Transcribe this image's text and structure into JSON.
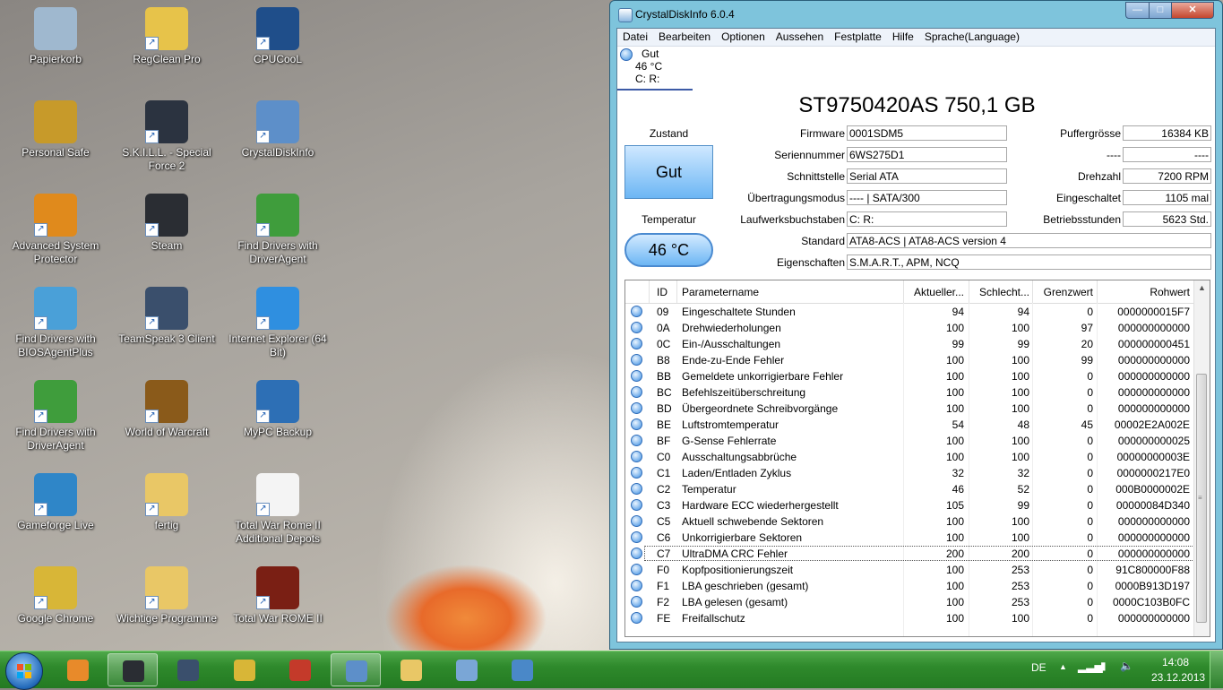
{
  "desktop": {
    "icons": [
      {
        "label": "Papierkorb",
        "icon": "recycle-bin-icon"
      },
      {
        "label": "RegClean Pro",
        "icon": "regclean-icon"
      },
      {
        "label": "CPUCooL",
        "icon": "cpucool-icon"
      },
      {
        "label": "Personal Safe",
        "icon": "padlock-icon"
      },
      {
        "label": "S.K.I.L.L. - Special Force 2",
        "icon": "sf2-icon"
      },
      {
        "label": "CrystalDiskInfo",
        "icon": "crystaldiskinfo-icon"
      },
      {
        "label": "Advanced System Protector",
        "icon": "shield-icon"
      },
      {
        "label": "Steam",
        "icon": "steam-icon"
      },
      {
        "label": "Find Drivers with DriverAgent",
        "icon": "driveragent-icon"
      },
      {
        "label": "Find Drivers with BIOSAgentPlus",
        "icon": "biosagent-icon"
      },
      {
        "label": "TeamSpeak 3 Client",
        "icon": "teamspeak-icon"
      },
      {
        "label": "Internet Explorer (64 Bit)",
        "icon": "internet-explorer-icon"
      },
      {
        "label": "Find Drivers with DriverAgent",
        "icon": "driveragent-icon"
      },
      {
        "label": "World of Warcraft",
        "icon": "wow-icon"
      },
      {
        "label": "MyPC Backup",
        "icon": "cloud-backup-icon"
      },
      {
        "label": "Gameforge Live",
        "icon": "gameforge-icon"
      },
      {
        "label": "fertig",
        "icon": "folder-icon"
      },
      {
        "label": "Total War Rome II Additional Depots",
        "icon": "file-icon"
      },
      {
        "label": "Google Chrome",
        "icon": "chrome-icon"
      },
      {
        "label": "Wichtige Programme",
        "icon": "folder-icon"
      },
      {
        "label": "Total War ROME II",
        "icon": "rome2-icon"
      }
    ]
  },
  "window": {
    "title": "CrystalDiskInfo 6.0.4",
    "minimize": "—",
    "maximize": "□",
    "close": "✕",
    "menu": [
      "Datei",
      "Bearbeiten",
      "Optionen",
      "Aussehen",
      "Festplatte",
      "Hilfe",
      "Sprache(Language)"
    ],
    "drive_tab": {
      "status": "Gut",
      "temp": "46 °C",
      "letters": "C: R:"
    },
    "model": "ST9750420AS 750,1 GB",
    "labels": {
      "zustand": "Zustand",
      "temperatur": "Temperatur",
      "firmware": "Firmware",
      "seriennummer": "Seriennummer",
      "schnittstelle": "Schnittstelle",
      "uebertragungsmodus": "Übertragungsmodus",
      "laufwerksbuchstaben": "Laufwerksbuchstaben",
      "standard": "Standard",
      "eigenschaften": "Eigenschaften",
      "puffergroesse": "Puffergrösse",
      "unknown": "----",
      "drehzahl": "Drehzahl",
      "eingeschaltet": "Eingeschaltet",
      "betriebsstunden": "Betriebsstunden"
    },
    "values": {
      "health": "Gut",
      "temperature": "46 °C",
      "firmware": "0001SDM5",
      "seriennummer": "6WS275D1",
      "schnittstelle": "Serial ATA",
      "uebertragungsmodus": "---- | SATA/300",
      "laufwerksbuchstaben": "C: R:",
      "standard": "ATA8-ACS | ATA8-ACS version 4",
      "eigenschaften": "S.M.A.R.T., APM, NCQ",
      "puffergroesse": "16384 KB",
      "unknown": "----",
      "drehzahl": "7200 RPM",
      "eingeschaltet": "1105 mal",
      "betriebsstunden": "5623 Std."
    },
    "table": {
      "headers": {
        "id": "ID",
        "name": "Parametername",
        "current": "Aktueller...",
        "worst": "Schlecht...",
        "threshold": "Grenzwert",
        "raw": "Rohwert"
      },
      "rows": [
        {
          "id": "09",
          "name": "Eingeschaltete Stunden",
          "current": "94",
          "worst": "94",
          "threshold": "0",
          "raw": "0000000015F7"
        },
        {
          "id": "0A",
          "name": "Drehwiederholungen",
          "current": "100",
          "worst": "100",
          "threshold": "97",
          "raw": "000000000000"
        },
        {
          "id": "0C",
          "name": "Ein-/Ausschaltungen",
          "current": "99",
          "worst": "99",
          "threshold": "20",
          "raw": "000000000451"
        },
        {
          "id": "B8",
          "name": "Ende-zu-Ende Fehler",
          "current": "100",
          "worst": "100",
          "threshold": "99",
          "raw": "000000000000"
        },
        {
          "id": "BB",
          "name": "Gemeldete unkorrigierbare Fehler",
          "current": "100",
          "worst": "100",
          "threshold": "0",
          "raw": "000000000000"
        },
        {
          "id": "BC",
          "name": "Befehlszeitüberschreitung",
          "current": "100",
          "worst": "100",
          "threshold": "0",
          "raw": "000000000000"
        },
        {
          "id": "BD",
          "name": "Übergeordnete Schreibvorgänge",
          "current": "100",
          "worst": "100",
          "threshold": "0",
          "raw": "000000000000"
        },
        {
          "id": "BE",
          "name": "Luftstromtemperatur",
          "current": "54",
          "worst": "48",
          "threshold": "45",
          "raw": "00002E2A002E"
        },
        {
          "id": "BF",
          "name": "G-Sense Fehlerrate",
          "current": "100",
          "worst": "100",
          "threshold": "0",
          "raw": "000000000025"
        },
        {
          "id": "C0",
          "name": "Ausschaltungsabbrüche",
          "current": "100",
          "worst": "100",
          "threshold": "0",
          "raw": "00000000003E"
        },
        {
          "id": "C1",
          "name": "Laden/Entladen Zyklus",
          "current": "32",
          "worst": "32",
          "threshold": "0",
          "raw": "0000000217E0"
        },
        {
          "id": "C2",
          "name": "Temperatur",
          "current": "46",
          "worst": "52",
          "threshold": "0",
          "raw": "000B0000002E"
        },
        {
          "id": "C3",
          "name": "Hardware ECC wiederhergestellt",
          "current": "105",
          "worst": "99",
          "threshold": "0",
          "raw": "00000084D340"
        },
        {
          "id": "C5",
          "name": "Aktuell schwebende Sektoren",
          "current": "100",
          "worst": "100",
          "threshold": "0",
          "raw": "000000000000"
        },
        {
          "id": "C6",
          "name": "Unkorrigierbare Sektoren",
          "current": "100",
          "worst": "100",
          "threshold": "0",
          "raw": "000000000000"
        },
        {
          "id": "C7",
          "name": "UltraDMA CRC Fehler",
          "current": "200",
          "worst": "200",
          "threshold": "0",
          "raw": "000000000000"
        },
        {
          "id": "F0",
          "name": "Kopfpositionierungszeit",
          "current": "100",
          "worst": "253",
          "threshold": "0",
          "raw": "91C800000F88"
        },
        {
          "id": "F1",
          "name": "LBA geschrieben (gesamt)",
          "current": "100",
          "worst": "253",
          "threshold": "0",
          "raw": "0000B913D197"
        },
        {
          "id": "F2",
          "name": "LBA gelesen (gesamt)",
          "current": "100",
          "worst": "253",
          "threshold": "0",
          "raw": "0000C103B0FC"
        },
        {
          "id": "FE",
          "name": "Freifallschutz",
          "current": "100",
          "worst": "100",
          "threshold": "0",
          "raw": "000000000000"
        }
      ],
      "selected_id": "C7"
    }
  },
  "taskbar": {
    "apps": [
      "media-player-icon",
      "steam-icon",
      "teamspeak-icon",
      "chrome-icon",
      "toolbox-icon",
      "crystaldiskinfo-icon",
      "explorer-folder-icon",
      "paint-icon",
      "screenshot-icon"
    ],
    "language": "DE",
    "time": "14:08",
    "date": "23.12.2013"
  },
  "colors": {
    "taskbar": "#2f8a2c",
    "window_frame": "#7ec4dc",
    "status_good": "#6cb6f4"
  }
}
